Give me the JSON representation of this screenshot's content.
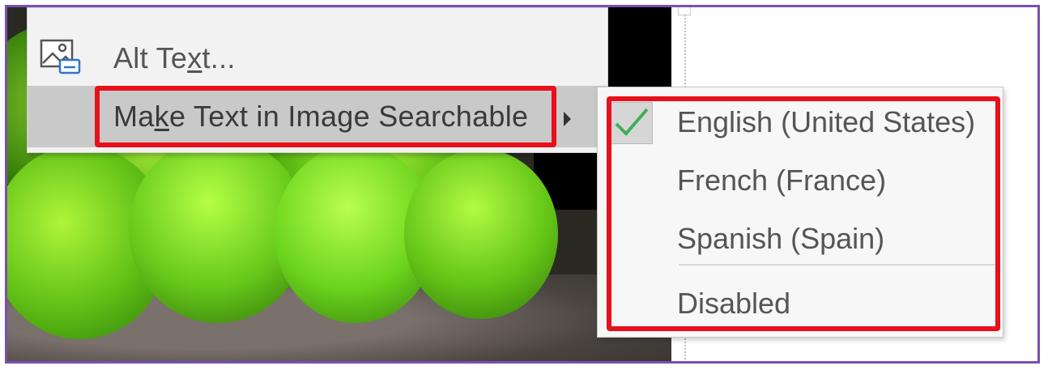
{
  "colors": {
    "highlight": "#e8101a",
    "frame": "#7a4fb0",
    "check": "#3fae5a"
  },
  "context_menu": {
    "items": [
      {
        "label_pre": "Alt Te",
        "label_key": "x",
        "label_post": "t...",
        "icon": "alt-text-icon"
      },
      {
        "label_pre": "Ma",
        "label_key": "k",
        "label_post": "e Text in Image Searchable",
        "icon": "submenu-arrow-icon",
        "highlighted": true
      }
    ]
  },
  "submenu": {
    "items": [
      {
        "label": "English (United States)",
        "checked": true
      },
      {
        "label": "French (France)",
        "checked": false
      },
      {
        "label": "Spanish (Spain)",
        "checked": false
      },
      {
        "label": "Disabled",
        "checked": false
      }
    ]
  }
}
